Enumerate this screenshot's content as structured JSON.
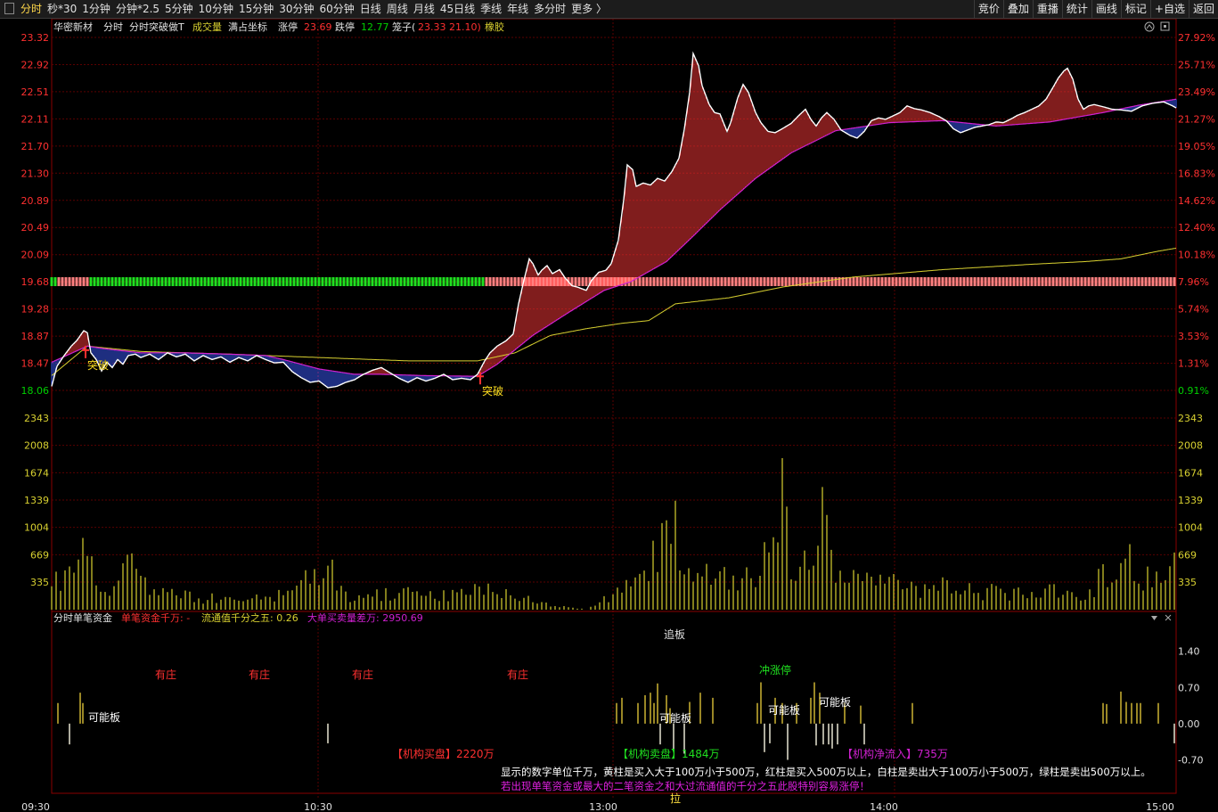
{
  "toolbar": {
    "tabs": [
      "分时",
      "秒*30",
      "1分钟",
      "分钟*2.5",
      "5分钟",
      "10分钟",
      "15分钟",
      "30分钟",
      "60分钟",
      "日线",
      "周线",
      "月线",
      "45日线",
      "季线",
      "年线",
      "多分时",
      "更多 〉"
    ],
    "right_tabs": [
      "竞价",
      "叠加",
      "重播",
      "统计",
      "画线",
      "标记",
      "+自选",
      "返回"
    ]
  },
  "header": {
    "stock": "华密新材",
    "mode": "分时",
    "indicator": "分时突破做T",
    "volume": "成交量",
    "coords": "满占坐标",
    "limit_up_label": "涨停",
    "limit_up": "23.69",
    "limit_down_label": "跌停",
    "limit_down": "12.77",
    "cage_label": "笼子(",
    "cage_values": "23.33 21.10)",
    "sector": "橡胶"
  },
  "colors": {
    "up": "#ff3030",
    "down": "#00d000",
    "price": "#ffffff",
    "avg": "#d8d030",
    "ma": "#d020d0",
    "grid": "#5a0000",
    "axis": "#8a0000"
  },
  "chart_data": {
    "type": "line",
    "y_left_ticks": [
      "23.32",
      "22.92",
      "22.51",
      "22.11",
      "21.70",
      "21.30",
      "20.89",
      "20.49",
      "20.09",
      "19.68",
      "19.28",
      "18.87",
      "18.47",
      "18.06"
    ],
    "y_right_ticks": [
      "27.92%",
      "25.71%",
      "23.49%",
      "21.27%",
      "19.05%",
      "16.83%",
      "14.62%",
      "12.40%",
      "10.18%",
      "7.96%",
      "5.74%",
      "3.53%",
      "1.31%",
      "0.91%"
    ],
    "ylim": [
      18.06,
      23.32
    ],
    "x_ticks": [
      "09:30",
      "10:30",
      "13:00",
      "14:00",
      "15:00"
    ],
    "price_keypoints": [
      [
        0,
        18.12
      ],
      [
        6,
        18.42
      ],
      [
        14,
        18.58
      ],
      [
        22,
        18.72
      ],
      [
        28,
        18.8
      ],
      [
        36,
        18.95
      ],
      [
        40,
        18.92
      ],
      [
        44,
        18.62
      ],
      [
        50,
        18.52
      ],
      [
        56,
        18.35
      ],
      [
        62,
        18.48
      ],
      [
        68,
        18.4
      ],
      [
        74,
        18.52
      ],
      [
        80,
        18.45
      ],
      [
        86,
        18.58
      ],
      [
        94,
        18.6
      ],
      [
        100,
        18.55
      ],
      [
        110,
        18.6
      ],
      [
        120,
        18.52
      ],
      [
        130,
        18.62
      ],
      [
        140,
        18.56
      ],
      [
        150,
        18.6
      ],
      [
        160,
        18.5
      ],
      [
        170,
        18.58
      ],
      [
        180,
        18.52
      ],
      [
        190,
        18.56
      ],
      [
        200,
        18.48
      ],
      [
        210,
        18.55
      ],
      [
        220,
        18.5
      ],
      [
        230,
        18.58
      ],
      [
        240,
        18.52
      ],
      [
        250,
        18.47
      ],
      [
        260,
        18.48
      ],
      [
        270,
        18.34
      ],
      [
        280,
        18.25
      ],
      [
        290,
        18.18
      ],
      [
        300,
        18.2
      ],
      [
        310,
        18.1
      ],
      [
        320,
        18.12
      ],
      [
        330,
        18.18
      ],
      [
        340,
        18.22
      ],
      [
        350,
        18.3
      ],
      [
        360,
        18.36
      ],
      [
        370,
        18.4
      ],
      [
        380,
        18.32
      ],
      [
        390,
        18.24
      ],
      [
        400,
        18.18
      ],
      [
        410,
        18.25
      ],
      [
        420,
        18.2
      ],
      [
        430,
        18.24
      ],
      [
        440,
        18.3
      ],
      [
        450,
        18.22
      ],
      [
        460,
        18.24
      ],
      [
        470,
        18.22
      ],
      [
        478,
        18.3
      ],
      [
        486,
        18.5
      ],
      [
        492,
        18.62
      ],
      [
        500,
        18.72
      ],
      [
        510,
        18.8
      ],
      [
        518,
        18.9
      ],
      [
        524,
        19.35
      ],
      [
        530,
        19.7
      ],
      [
        536,
        20.02
      ],
      [
        540,
        19.95
      ],
      [
        546,
        19.78
      ],
      [
        550,
        19.85
      ],
      [
        556,
        19.92
      ],
      [
        562,
        19.8
      ],
      [
        570,
        19.86
      ],
      [
        576,
        19.74
      ],
      [
        584,
        19.62
      ],
      [
        590,
        19.6
      ],
      [
        600,
        19.55
      ],
      [
        606,
        19.7
      ],
      [
        614,
        19.82
      ],
      [
        622,
        19.85
      ],
      [
        628,
        19.95
      ],
      [
        636,
        20.3
      ],
      [
        642,
        20.9
      ],
      [
        646,
        21.42
      ],
      [
        652,
        21.35
      ],
      [
        656,
        21.1
      ],
      [
        664,
        21.15
      ],
      [
        672,
        21.12
      ],
      [
        680,
        21.22
      ],
      [
        688,
        21.18
      ],
      [
        696,
        21.32
      ],
      [
        704,
        21.52
      ],
      [
        710,
        21.95
      ],
      [
        716,
        22.5
      ],
      [
        720,
        23.08
      ],
      [
        726,
        22.9
      ],
      [
        730,
        22.6
      ],
      [
        738,
        22.32
      ],
      [
        744,
        22.2
      ],
      [
        750,
        22.18
      ],
      [
        758,
        21.92
      ],
      [
        762,
        22.05
      ],
      [
        770,
        22.42
      ],
      [
        776,
        22.62
      ],
      [
        782,
        22.5
      ],
      [
        790,
        22.2
      ],
      [
        796,
        22.05
      ],
      [
        804,
        21.92
      ],
      [
        812,
        21.9
      ],
      [
        820,
        21.96
      ],
      [
        830,
        22.04
      ],
      [
        838,
        22.15
      ],
      [
        846,
        22.25
      ],
      [
        852,
        22.1
      ],
      [
        858,
        22.0
      ],
      [
        864,
        22.12
      ],
      [
        870,
        22.2
      ],
      [
        878,
        22.1
      ],
      [
        886,
        21.94
      ],
      [
        896,
        21.86
      ],
      [
        904,
        21.82
      ],
      [
        912,
        21.92
      ],
      [
        920,
        22.08
      ],
      [
        928,
        22.12
      ],
      [
        936,
        22.1
      ],
      [
        944,
        22.15
      ],
      [
        952,
        22.2
      ],
      [
        960,
        22.3
      ],
      [
        968,
        22.26
      ],
      [
        976,
        22.24
      ],
      [
        986,
        22.2
      ],
      [
        996,
        22.14
      ],
      [
        1004,
        22.08
      ],
      [
        1012,
        21.96
      ],
      [
        1020,
        21.9
      ],
      [
        1028,
        21.94
      ],
      [
        1036,
        21.98
      ],
      [
        1044,
        22.0
      ],
      [
        1052,
        22.02
      ],
      [
        1060,
        22.06
      ],
      [
        1068,
        22.05
      ],
      [
        1076,
        22.1
      ],
      [
        1084,
        22.16
      ],
      [
        1092,
        22.2
      ],
      [
        1100,
        22.25
      ],
      [
        1108,
        22.3
      ],
      [
        1116,
        22.4
      ],
      [
        1124,
        22.58
      ],
      [
        1130,
        22.72
      ],
      [
        1136,
        22.82
      ],
      [
        1140,
        22.86
      ],
      [
        1146,
        22.7
      ],
      [
        1152,
        22.4
      ],
      [
        1158,
        22.25
      ],
      [
        1164,
        22.3
      ],
      [
        1170,
        22.32
      ],
      [
        1176,
        22.3
      ],
      [
        1182,
        22.28
      ],
      [
        1190,
        22.25
      ],
      [
        1200,
        22.24
      ],
      [
        1212,
        22.22
      ],
      [
        1224,
        22.3
      ],
      [
        1236,
        22.34
      ],
      [
        1248,
        22.36
      ],
      [
        1258,
        22.3
      ],
      [
        1262,
        22.27
      ]
    ],
    "avg_keypoints": [
      [
        0,
        18.28
      ],
      [
        40,
        18.72
      ],
      [
        100,
        18.64
      ],
      [
        200,
        18.6
      ],
      [
        300,
        18.55
      ],
      [
        400,
        18.5
      ],
      [
        478,
        18.5
      ],
      [
        520,
        18.62
      ],
      [
        560,
        18.88
      ],
      [
        600,
        18.98
      ],
      [
        640,
        19.06
      ],
      [
        670,
        19.1
      ],
      [
        700,
        19.35
      ],
      [
        760,
        19.44
      ],
      [
        820,
        19.6
      ],
      [
        900,
        19.75
      ],
      [
        1000,
        19.86
      ],
      [
        1100,
        19.94
      ],
      [
        1160,
        19.98
      ],
      [
        1200,
        20.02
      ],
      [
        1240,
        20.13
      ],
      [
        1262,
        20.18
      ]
    ],
    "ma_keypoints": [
      [
        0,
        18.48
      ],
      [
        20,
        18.6
      ],
      [
        40,
        18.72
      ],
      [
        60,
        18.68
      ],
      [
        100,
        18.62
      ],
      [
        150,
        18.62
      ],
      [
        200,
        18.6
      ],
      [
        240,
        18.58
      ],
      [
        260,
        18.52
      ],
      [
        300,
        18.38
      ],
      [
        340,
        18.3
      ],
      [
        370,
        18.3
      ],
      [
        420,
        18.28
      ],
      [
        478,
        18.27
      ],
      [
        500,
        18.45
      ],
      [
        540,
        18.88
      ],
      [
        580,
        19.22
      ],
      [
        620,
        19.55
      ],
      [
        650,
        19.68
      ],
      [
        690,
        19.98
      ],
      [
        720,
        20.36
      ],
      [
        750,
        20.75
      ],
      [
        790,
        21.22
      ],
      [
        830,
        21.6
      ],
      [
        880,
        21.93
      ],
      [
        940,
        22.05
      ],
      [
        1000,
        22.08
      ],
      [
        1060,
        22.0
      ],
      [
        1120,
        22.06
      ],
      [
        1180,
        22.2
      ],
      [
        1220,
        22.31
      ],
      [
        1262,
        22.4
      ]
    ],
    "tape_threshold": 19.68,
    "volume_yticks": [
      "2343",
      "2008",
      "1674",
      "1339",
      "1004",
      "669",
      "335"
    ],
    "volume_ylim": [
      0,
      2343
    ],
    "volume_peaks": [
      [
        3,
        820
      ],
      [
        8,
        570
      ],
      [
        16,
        780
      ],
      [
        22,
        550
      ],
      [
        30,
        620
      ],
      [
        36,
        1330
      ],
      [
        48,
        560
      ],
      [
        60,
        470
      ],
      [
        72,
        360
      ],
      [
        86,
        930
      ],
      [
        96,
        560
      ],
      [
        108,
        380
      ],
      [
        130,
        300
      ],
      [
        170,
        200
      ],
      [
        210,
        210
      ],
      [
        250,
        200
      ],
      [
        310,
        760
      ],
      [
        330,
        240
      ],
      [
        400,
        300
      ],
      [
        440,
        280
      ],
      [
        490,
        370
      ],
      [
        520,
        210
      ],
      [
        600,
        0
      ],
      [
        612,
        120
      ],
      [
        630,
        230
      ],
      [
        648,
        520
      ],
      [
        658,
        480
      ],
      [
        670,
        680
      ],
      [
        684,
        1500
      ],
      [
        696,
        1600
      ],
      [
        706,
        1150
      ],
      [
        716,
        700
      ],
      [
        726,
        790
      ],
      [
        736,
        570
      ],
      [
        746,
        700
      ],
      [
        756,
        550
      ],
      [
        770,
        520
      ],
      [
        788,
        580
      ],
      [
        802,
        880
      ],
      [
        812,
        1600
      ],
      [
        820,
        1900
      ],
      [
        830,
        700
      ],
      [
        840,
        900
      ],
      [
        856,
        780
      ],
      [
        866,
        1590
      ],
      [
        876,
        680
      ],
      [
        888,
        560
      ],
      [
        904,
        600
      ],
      [
        924,
        680
      ],
      [
        944,
        520
      ],
      [
        960,
        480
      ],
      [
        980,
        380
      ],
      [
        1000,
        410
      ],
      [
        1040,
        330
      ],
      [
        1080,
        300
      ],
      [
        1120,
        320
      ],
      [
        1160,
        300
      ],
      [
        1186,
        650
      ],
      [
        1200,
        670
      ],
      [
        1214,
        980
      ],
      [
        1224,
        640
      ],
      [
        1236,
        650
      ],
      [
        1248,
        600
      ],
      [
        1262,
        850
      ]
    ],
    "fund_title": "分时单笔资金",
    "fund_param1": "单笔资金千万: -",
    "fund_param2": "流通值千分之五: 0.26",
    "fund_param3": "大单买卖量差万: 2950.69",
    "fund_yticks": [
      "1.40",
      "0.70",
      "0.00",
      "-0.70"
    ],
    "fund_ylim": [
      -0.95,
      1.55
    ],
    "fund_bars": [
      [
        7,
        0.4
      ],
      [
        20,
        -0.4
      ],
      [
        32,
        0.6
      ],
      [
        35,
        0.4
      ],
      [
        310,
        -0.38
      ],
      [
        634,
        0.4
      ],
      [
        640,
        0.5
      ],
      [
        658,
        0.4
      ],
      [
        666,
        0.55
      ],
      [
        672,
        0.6
      ],
      [
        676,
        0.4
      ],
      [
        680,
        0.78
      ],
      [
        683,
        -0.4
      ],
      [
        690,
        0.55
      ],
      [
        694,
        0.3
      ],
      [
        698,
        -0.5
      ],
      [
        710,
        -0.58
      ],
      [
        716,
        0.42
      ],
      [
        728,
        0.6
      ],
      [
        742,
        0.5
      ],
      [
        792,
        0.4
      ],
      [
        796,
        0.8
      ],
      [
        800,
        -0.55
      ],
      [
        806,
        -0.38
      ],
      [
        812,
        0.5
      ],
      [
        820,
        0.4
      ],
      [
        826,
        -0.7
      ],
      [
        836,
        0.4
      ],
      [
        852,
        0.5
      ],
      [
        856,
        0.8
      ],
      [
        858,
        -0.42
      ],
      [
        862,
        0.6
      ],
      [
        866,
        -0.4
      ],
      [
        872,
        -0.4
      ],
      [
        876,
        -0.48
      ],
      [
        882,
        -0.4
      ],
      [
        890,
        0.4
      ],
      [
        908,
        0.35
      ],
      [
        912,
        -0.4
      ],
      [
        966,
        0.4
      ],
      [
        1180,
        0.4
      ],
      [
        1184,
        0.38
      ],
      [
        1200,
        0.62
      ],
      [
        1206,
        0.42
      ],
      [
        1212,
        0.4
      ],
      [
        1218,
        0.4
      ],
      [
        1222,
        0.4
      ],
      [
        1242,
        0.4
      ],
      [
        1260,
        -0.38
      ]
    ],
    "annotations": {
      "breakout": "突破",
      "top": "追板",
      "surge": "冲涨停",
      "possible": "可能板",
      "dealer": "有庄",
      "inst_buy": "【机构买盘】2220万",
      "inst_sell": "【机构卖盘】1484万",
      "inst_net": "【机构净流入】735万",
      "pull": "拉",
      "note1": "显示的数字单位千万，黄柱是买入大于100万小于500万，红柱是买入500万以上，白柱是卖出大于100万小于500万，绿柱是卖出500万以上。",
      "note2": "若出现单笔资金或最大的二笔资金之和大过流通值的千分之五此股特别容易涨停！"
    }
  }
}
